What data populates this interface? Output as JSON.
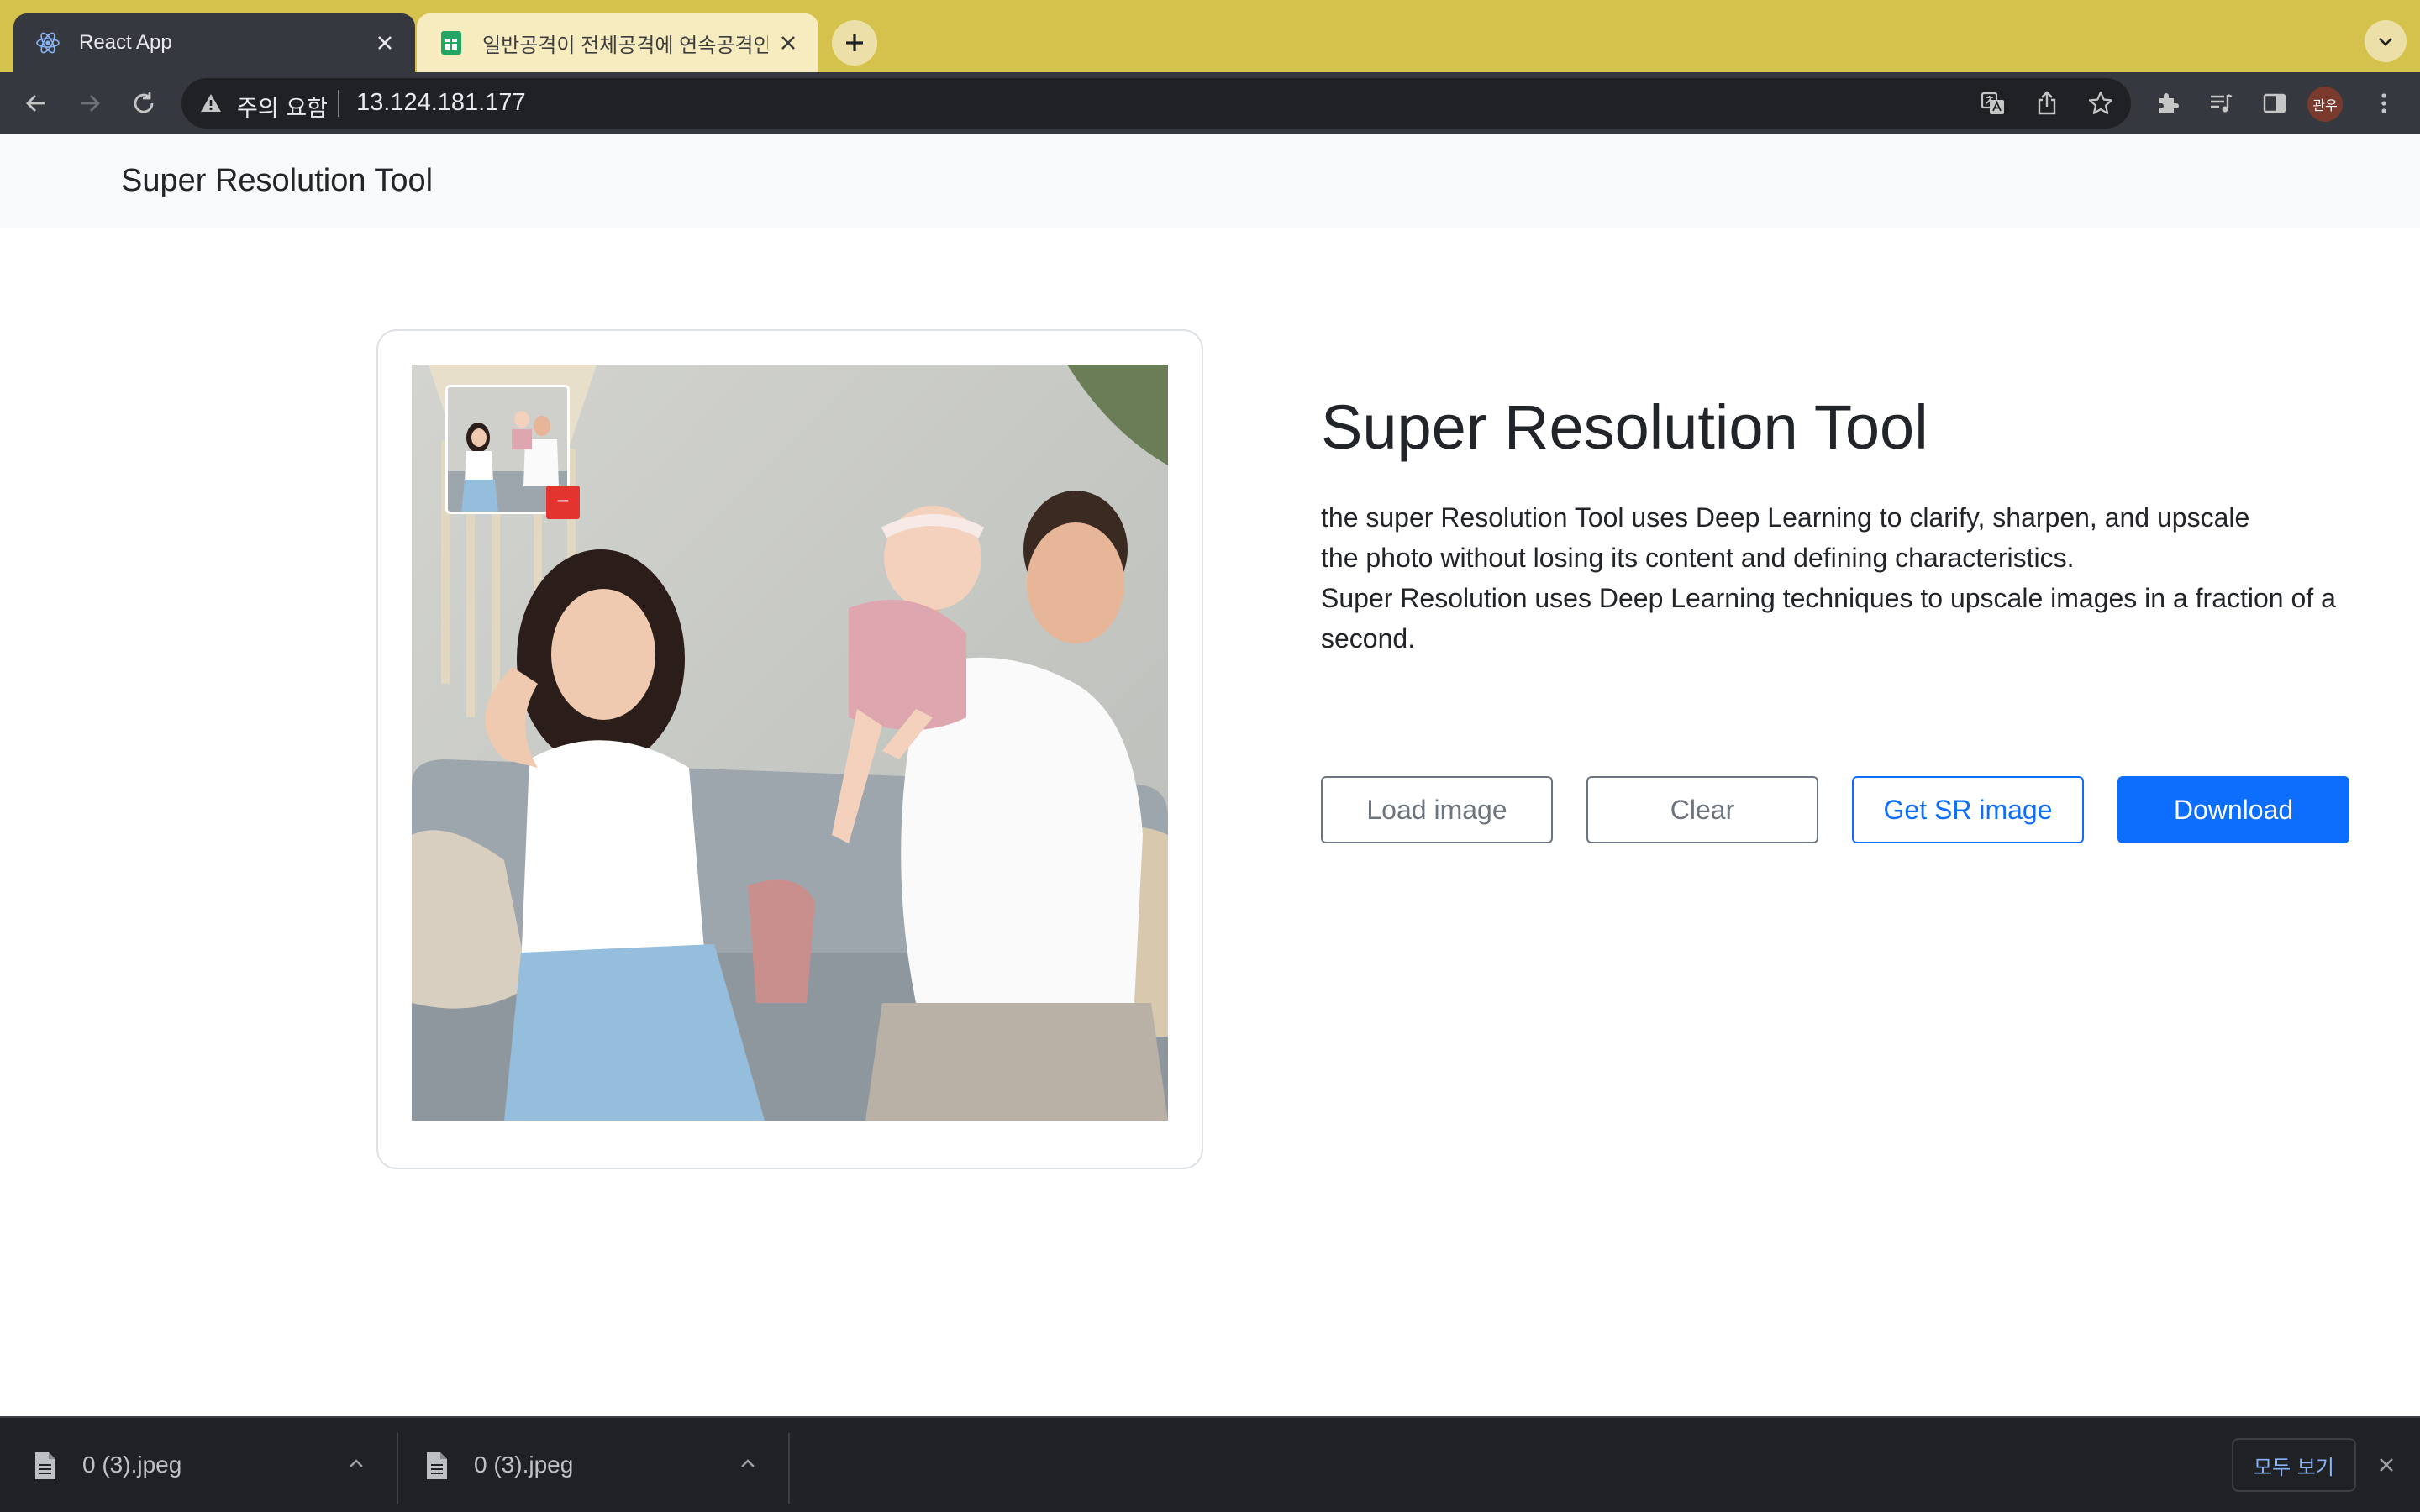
{
  "browser": {
    "tabs": [
      {
        "title": "React App",
        "icon": "react-logo-icon",
        "active": true
      },
      {
        "title": "일반공격이 전체공격에 연속공격인 인",
        "icon": "sheets-icon",
        "active": false
      }
    ],
    "security_label": "주의 요함",
    "url": "13.124.181.177",
    "profile_initials": "관우"
  },
  "page": {
    "navbar_brand": "Super Resolution Tool",
    "title": "Super Resolution Tool",
    "description": [
      "the super Resolution Tool uses Deep Learning to clarify, sharpen, and upscale",
      "the photo without losing its content and defining characteristics.",
      "Super Resolution uses Deep Learning techniques to upscale images in a fraction of a second."
    ],
    "thumb_remove_label": "−",
    "buttons": {
      "load": "Load image",
      "clear": "Clear",
      "get_sr": "Get SR image",
      "download": "Download"
    }
  },
  "downloads": {
    "items": [
      {
        "filename": "0 (3).jpeg"
      },
      {
        "filename": "0 (3).jpeg"
      }
    ],
    "show_all_label": "모두 보기"
  },
  "colors": {
    "tab_strip": "#d4c24d",
    "chrome_dark": "#35393f",
    "primary": "#0d6efd",
    "secondary": "#6c757d",
    "danger": "#e3342f"
  }
}
